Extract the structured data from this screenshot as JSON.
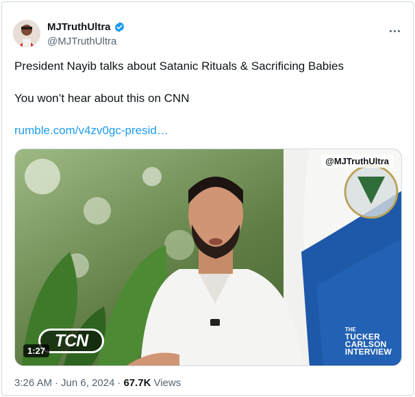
{
  "author": {
    "display_name": "MJTruthUltra",
    "handle": "@MJTruthUltra",
    "verified": true
  },
  "tweet": {
    "line1": "President Nayib talks about Satanic Rituals & Sacrificing Babies",
    "line2": "You won’t hear about this on CNN",
    "link_text": "rumble.com/v4zv0gc-presid…"
  },
  "media": {
    "watermark": "@MJTruthUltra",
    "duration": "1:27",
    "logo_text": "TCN",
    "show_badge": {
      "the": "THE",
      "line1": "TUCKER",
      "line2": "CARLSON",
      "line3": "INTERVIEW"
    }
  },
  "footer": {
    "time": "3:26 AM",
    "separator1": "·",
    "date": "Jun 6, 2024",
    "separator2": "·",
    "views_count": "67.7K",
    "views_label": "Views"
  },
  "colors": {
    "accent": "#1d9bf0",
    "text": "#0f1419",
    "secondary": "#536471",
    "border": "#cfd9de"
  },
  "icons": {
    "verified": "verified-badge-icon",
    "more": "more-horizontal-icon"
  }
}
